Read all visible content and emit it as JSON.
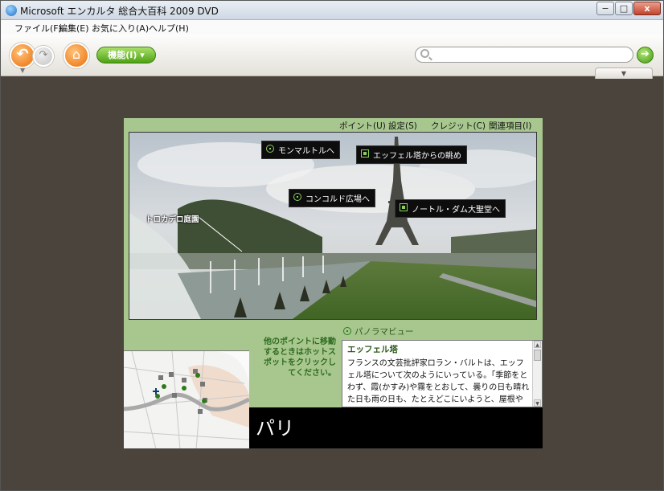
{
  "window": {
    "title": "Microsoft エンカルタ 総合大百科 2009 DVD",
    "min_glyph": "−",
    "max_glyph": "□",
    "close_glyph": "x"
  },
  "menu": [
    "ファイル(F)",
    "編集(E)",
    "お気に入り(A)",
    "ヘルプ(H)"
  ],
  "toolbar": {
    "back_glyph": "↶",
    "forward_glyph": "↷",
    "home_glyph": "⌂",
    "features_label": "機能(I) ▾",
    "search_placeholder": "",
    "go_glyph": "➔",
    "dropdown_glyph": "▼"
  },
  "article": {
    "subnav": [
      "ポイント(U)",
      "設定(S)",
      "クレジット(C)",
      "関連項目(I)"
    ],
    "hotspots": [
      {
        "label": "モンマルトルへ",
        "kind": "move"
      },
      {
        "label": "エッフェル塔からの眺め",
        "kind": "view"
      },
      {
        "label": "コンコルド広場へ",
        "kind": "move"
      },
      {
        "label": "ノートル・ダム大聖堂へ",
        "kind": "view"
      }
    ],
    "trocadero_label": "トロカデロ庭園",
    "panorama_mode": "パノラマビュー",
    "hint": "他のポイントに移動するときはホットスポットをクリックしてください。",
    "text_heading": "エッフェル塔",
    "text_body": "フランスの文芸批評家ロラン・バルトは、エッフェル塔について次のようにいっている。「季節をとわず、霞(かすみ)や霧をとおして、曇りの日も晴れた日も雨の日も、たとえどこにいようと、屋根やドームや木の枝の様子がどうであろうと、塔はそこにある……パリジャンが",
    "city_title": "パリ"
  },
  "colors": {
    "accent_orange": "#ea6d0a",
    "accent_green": "#4ea214",
    "panel_green": "#a8c78f",
    "workspace": "#4b443d"
  }
}
